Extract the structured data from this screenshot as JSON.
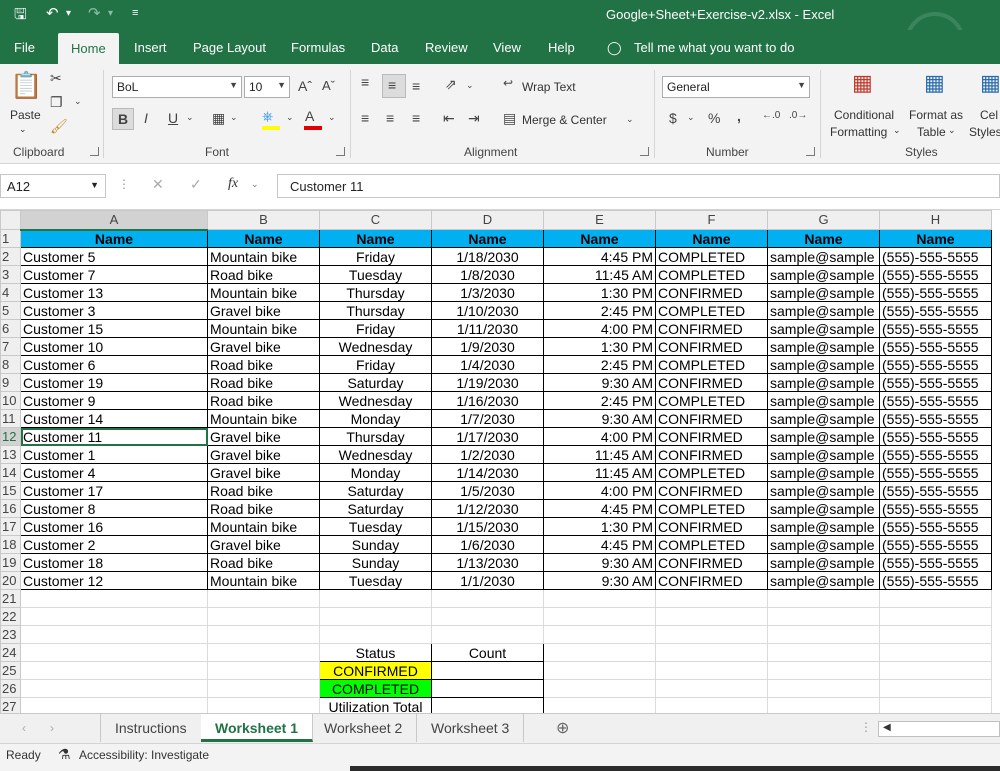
{
  "window": {
    "title": "Google+Sheet+Exercise-v2.xlsx  -  Excel"
  },
  "ribbon_tabs": [
    "File",
    "Home",
    "Insert",
    "Page Layout",
    "Formulas",
    "Data",
    "Review",
    "View",
    "Help"
  ],
  "tell_me": "Tell me what you want to do",
  "ribbon": {
    "clipboard": {
      "paste": "Paste",
      "group": "Clipboard"
    },
    "font": {
      "name": "BoL",
      "size": "10",
      "bold": "B",
      "italic": "I",
      "underline": "U",
      "group": "Font"
    },
    "alignment": {
      "wrap": "Wrap Text",
      "merge": "Merge & Center",
      "group": "Alignment"
    },
    "number": {
      "format": "General",
      "currency": "$",
      "percent": "%",
      "comma": ",",
      "group": "Number"
    },
    "styles": {
      "conditional_1": "Conditional",
      "conditional_2": "Formatting",
      "format_table_1": "Format as",
      "format_table_2": "Table",
      "cell_styles_1": "Cel",
      "cell_styles_2": "Styles",
      "group": "Styles"
    }
  },
  "formula_bar": {
    "name_box": "A12",
    "fx": "fx",
    "content": "Customer 11"
  },
  "columns": [
    "A",
    "B",
    "C",
    "D",
    "E",
    "F",
    "G",
    "H"
  ],
  "header_row": [
    "Name",
    "Name",
    "Name",
    "Name",
    "Name",
    "Name",
    "Name",
    "Name"
  ],
  "rows": [
    [
      "Customer 5",
      "Mountain bike",
      "Friday",
      "1/18/2030",
      "4:45 PM",
      "COMPLETED",
      "sample@sample",
      "(555)-555-5555"
    ],
    [
      "Customer 7",
      "Road bike",
      "Tuesday",
      "1/8/2030",
      "11:45 AM",
      "COMPLETED",
      "sample@sample",
      "(555)-555-5555"
    ],
    [
      "Customer 13",
      "Mountain bike",
      "Thursday",
      "1/3/2030",
      "1:30 PM",
      "CONFIRMED",
      "sample@sample",
      "(555)-555-5555"
    ],
    [
      "Customer 3",
      "Gravel bike",
      "Thursday",
      "1/10/2030",
      "2:45 PM",
      "COMPLETED",
      "sample@sample",
      "(555)-555-5555"
    ],
    [
      "Customer 15",
      "Mountain bike",
      "Friday",
      "1/11/2030",
      "4:00 PM",
      "CONFIRMED",
      "sample@sample",
      "(555)-555-5555"
    ],
    [
      "Customer 10",
      "Gravel bike",
      "Wednesday",
      "1/9/2030",
      "1:30 PM",
      "CONFIRMED",
      "sample@sample",
      "(555)-555-5555"
    ],
    [
      "Customer 6",
      "Road bike",
      "Friday",
      "1/4/2030",
      "2:45 PM",
      "COMPLETED",
      "sample@sample",
      "(555)-555-5555"
    ],
    [
      "Customer 19",
      "Road bike",
      "Saturday",
      "1/19/2030",
      "9:30 AM",
      "CONFIRMED",
      "sample@sample",
      "(555)-555-5555"
    ],
    [
      "Customer 9",
      "Road bike",
      "Wednesday",
      "1/16/2030",
      "2:45 PM",
      "COMPLETED",
      "sample@sample",
      "(555)-555-5555"
    ],
    [
      "Customer 14",
      "Mountain bike",
      "Monday",
      "1/7/2030",
      "9:30 AM",
      "CONFIRMED",
      "sample@sample",
      "(555)-555-5555"
    ],
    [
      "Customer 11",
      "Gravel bike",
      "Thursday",
      "1/17/2030",
      "4:00 PM",
      "CONFIRMED",
      "sample@sample",
      "(555)-555-5555"
    ],
    [
      "Customer 1",
      "Gravel bike",
      "Wednesday",
      "1/2/2030",
      "11:45 AM",
      "CONFIRMED",
      "sample@sample",
      "(555)-555-5555"
    ],
    [
      "Customer 4",
      "Gravel bike",
      "Monday",
      "1/14/2030",
      "11:45 AM",
      "COMPLETED",
      "sample@sample",
      "(555)-555-5555"
    ],
    [
      "Customer 17",
      "Road bike",
      "Saturday",
      "1/5/2030",
      "4:00 PM",
      "CONFIRMED",
      "sample@sample",
      "(555)-555-5555"
    ],
    [
      "Customer 8",
      "Road bike",
      "Saturday",
      "1/12/2030",
      "4:45 PM",
      "COMPLETED",
      "sample@sample",
      "(555)-555-5555"
    ],
    [
      "Customer 16",
      "Mountain bike",
      "Tuesday",
      "1/15/2030",
      "1:30 PM",
      "CONFIRMED",
      "sample@sample",
      "(555)-555-5555"
    ],
    [
      "Customer 2",
      "Gravel bike",
      "Sunday",
      "1/6/2030",
      "4:45 PM",
      "COMPLETED",
      "sample@sample",
      "(555)-555-5555"
    ],
    [
      "Customer 18",
      "Road bike",
      "Sunday",
      "1/13/2030",
      "9:30 AM",
      "CONFIRMED",
      "sample@sample",
      "(555)-555-5555"
    ],
    [
      "Customer 12",
      "Mountain bike",
      "Tuesday",
      "1/1/2030",
      "9:30 AM",
      "CONFIRMED",
      "sample@sample",
      "(555)-555-5555"
    ]
  ],
  "summary": {
    "status_header": "Status",
    "count_header": "Count",
    "confirmed": "CONFIRMED",
    "completed": "COMPLETED",
    "total": "Utilization Total"
  },
  "sheet_tabs": [
    "Instructions",
    "Worksheet 1",
    "Worksheet 2",
    "Worksheet 3"
  ],
  "active_sheet": "Worksheet 1",
  "status": {
    "ready": "Ready",
    "accessibility": "Accessibility: Investigate"
  },
  "colors": {
    "excel_green": "#217346",
    "header_fill": "#00b0f0",
    "confirmed_fill": "#ffff00",
    "completed_fill": "#00ff00"
  }
}
